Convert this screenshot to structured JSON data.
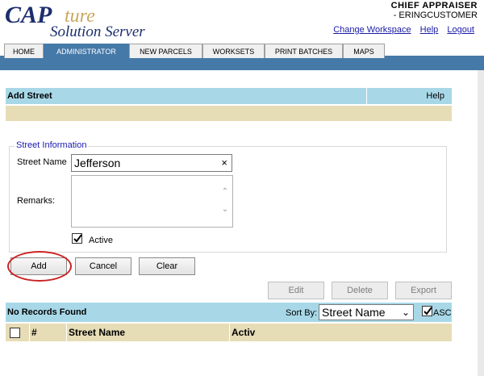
{
  "header": {
    "logo_text": "CAPture Solution Server",
    "user_role": "CHIEF  APPRAISER",
    "user_name": "- ERINGCUSTOMER",
    "links": [
      "Change Workspace",
      "Help",
      "Logout"
    ]
  },
  "tabs": [
    {
      "label": "HOME",
      "active": false
    },
    {
      "label": "ADMINISTRATOR",
      "active": true
    },
    {
      "label": "NEW PARCELS",
      "active": false
    },
    {
      "label": "WORKSETS",
      "active": false
    },
    {
      "label": "PRINT BATCHES",
      "active": false
    },
    {
      "label": "MAPS",
      "active": false
    }
  ],
  "page": {
    "title": "Add Street",
    "help": "Help"
  },
  "form": {
    "legend": "Street Information",
    "street_name_label": "Street Name",
    "street_name_value": "Jefferson",
    "clear_icon": "×",
    "remarks_label": "Remarks:",
    "remarks_value": "",
    "active_label": "Active",
    "active_checked": true
  },
  "buttons": {
    "add": "Add",
    "cancel": "Cancel",
    "clear": "Clear",
    "edit": "Edit",
    "delete": "Delete",
    "export": "Export"
  },
  "list": {
    "status": "No Records Found",
    "sort_label": "Sort By:",
    "sort_value": "Street Name",
    "asc_label": "ASC",
    "asc_checked": true,
    "columns": [
      "#",
      "Street Name",
      "Activ"
    ]
  },
  "colors": {
    "tab_active": "#4579a8",
    "title_bar": "#a8d8e8",
    "tan_bar": "#e6dcb6",
    "highlight_oval": "#cc2222"
  }
}
